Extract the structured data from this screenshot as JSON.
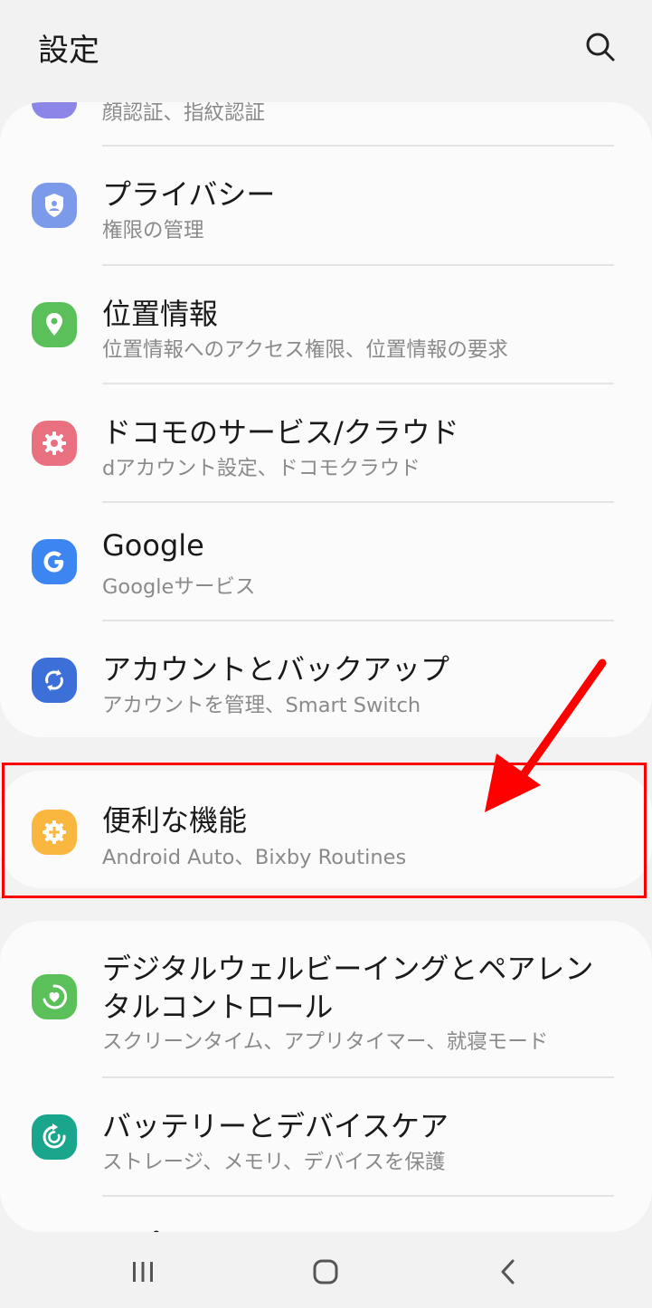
{
  "header": {
    "title": "設定"
  },
  "card1": {
    "partial_item": {
      "subtitle": "顔認証、指紋認証"
    },
    "items": [
      {
        "title": "プライバシー",
        "subtitle": "権限の管理",
        "icon": "shield-user-icon",
        "color": "#7b9bea"
      },
      {
        "title": "位置情報",
        "subtitle": "位置情報へのアクセス権限、位置情報の要求",
        "icon": "location-pin-icon",
        "color": "#5bc05a"
      },
      {
        "title": "ドコモのサービス/クラウド",
        "subtitle": "dアカウント設定、ドコモクラウド",
        "icon": "gear-icon",
        "color": "#e9707f"
      },
      {
        "title": "Google",
        "subtitle": "Googleサービス",
        "icon": "google-icon",
        "color": "#3d86f2"
      },
      {
        "title": "アカウントとバックアップ",
        "subtitle": "アカウントを管理、Smart Switch",
        "icon": "sync-icon",
        "color": "#3c6fd8"
      }
    ]
  },
  "card2": {
    "items": [
      {
        "title": "便利な機能",
        "subtitle": "Android Auto、Bixby Routines",
        "icon": "plus-gear-icon",
        "color": "#f9b740"
      }
    ]
  },
  "card3": {
    "items": [
      {
        "title_line1": "デジタルウェルビーイングとペアレン",
        "title_line2": "タルコントロール",
        "subtitle": "スクリーンタイム、アプリタイマー、就寝モード",
        "icon": "wellbeing-heart-icon",
        "color": "#5bc05a"
      },
      {
        "title": "バッテリーとデバイスケア",
        "subtitle": "ストレージ、メモリ、デバイスを保護",
        "icon": "device-care-icon",
        "color": "#1aa68d"
      },
      {
        "title": "アプリ"
      }
    ]
  },
  "annotation": {
    "arrow_color": "#ff0000",
    "box_color": "#ff0000"
  },
  "navbar": {
    "icons": [
      "recent-apps-icon",
      "home-icon",
      "back-icon"
    ]
  }
}
